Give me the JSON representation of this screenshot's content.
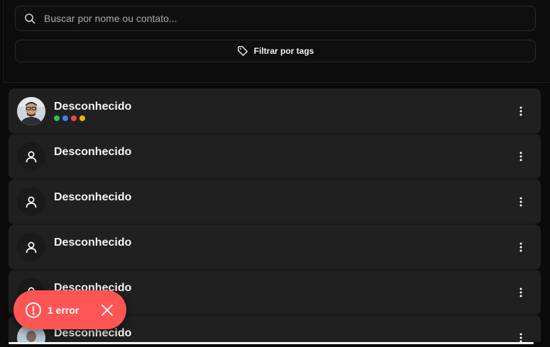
{
  "search": {
    "placeholder": "Buscar por nome ou contato..."
  },
  "filter": {
    "label": "Filtrar por tags"
  },
  "contacts": [
    {
      "name": "Desconhecido",
      "avatar": "photo",
      "tags": [
        "#22c55e",
        "#3b82f6",
        "#ef4444",
        "#eab308"
      ]
    },
    {
      "name": "Desconhecido",
      "avatar": "user-icon"
    },
    {
      "name": "Desconhecido",
      "avatar": "user-icon"
    },
    {
      "name": "Desconhecido",
      "avatar": "user-icon"
    },
    {
      "name": "Desconhecido",
      "avatar": "user-icon"
    },
    {
      "name": "Desconhecido",
      "avatar": "photo"
    }
  ],
  "toast": {
    "text": "1 error",
    "color": "#ff5555"
  },
  "colors": {
    "background": "#0b0b0b",
    "card": "#202020",
    "border": "#2a2a2a"
  }
}
